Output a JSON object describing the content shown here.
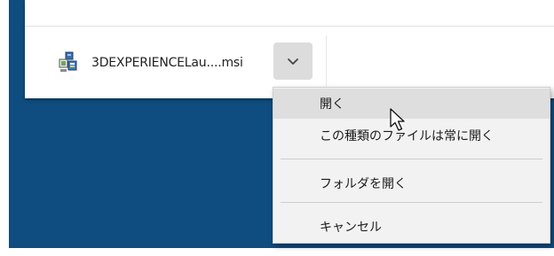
{
  "download_item": {
    "file_name": "3DEXPERIENCELau....msi",
    "file_icon": "msi-installer-icon",
    "dropdown_icon": "chevron-down-icon"
  },
  "context_menu": {
    "items": [
      {
        "label": "開く",
        "state": "highlighted"
      },
      {
        "label": "この種類のファイルは常に開く",
        "state": "normal"
      },
      {
        "label": "フォルダを開く",
        "state": "normal"
      },
      {
        "label": "キャンセル",
        "state": "normal"
      }
    ]
  },
  "colors": {
    "desktop_background": "#0f4c7f",
    "menu_background": "#f2f2f2",
    "menu_highlight": "#dedede",
    "dropdown_button": "#dcdcdc"
  }
}
